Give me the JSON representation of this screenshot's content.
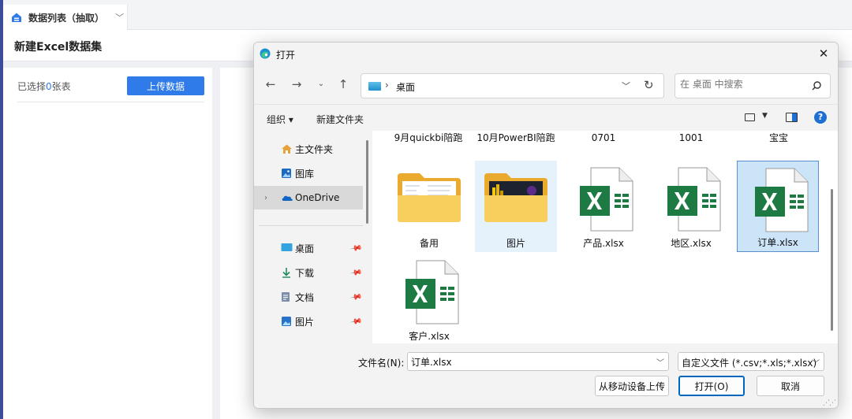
{
  "app": {
    "tab_label": "数据列表（抽取）",
    "page_title": "新建Excel数据集",
    "selected_prefix": "已选择",
    "selected_count": "0",
    "selected_suffix": "张表",
    "upload_button": "上传数据"
  },
  "dialog": {
    "title": "打开",
    "address": "桌面",
    "search_placeholder": "在 桌面 中搜索",
    "toolbar": {
      "organize": "组织 ▾",
      "new_folder": "新建文件夹"
    },
    "sidebar": [
      {
        "label": "主文件夹",
        "icon": "home-icon"
      },
      {
        "label": "图库",
        "icon": "gallery-icon"
      },
      {
        "label": "OneDrive",
        "icon": "cloud-icon",
        "active": true
      },
      {
        "label": "桌面",
        "icon": "desktop-icon",
        "pinned": true
      },
      {
        "label": "下载",
        "icon": "download-icon",
        "pinned": true
      },
      {
        "label": "文档",
        "icon": "document-icon",
        "pinned": true
      },
      {
        "label": "图片",
        "icon": "pictures-icon",
        "pinned": true
      }
    ],
    "top_row": [
      "9月quickbi陪跑",
      "10月PowerBI陪跑",
      "0701",
      "1001",
      "宝宝"
    ],
    "files": [
      {
        "name": "备用",
        "kind": "folder"
      },
      {
        "name": "图片",
        "kind": "folder-image",
        "state": "hover"
      },
      {
        "name": "产品.xlsx",
        "kind": "excel"
      },
      {
        "name": "地区.xlsx",
        "kind": "excel"
      },
      {
        "name": "订单.xlsx",
        "kind": "excel",
        "state": "selected"
      },
      {
        "name": "客户.xlsx",
        "kind": "excel"
      }
    ],
    "filename_label": "文件名(N):",
    "filename_value": "订单.xlsx",
    "filetype": "自定义文件 (*.csv;*.xls;*.xlsx)",
    "buttons": {
      "mobile_upload": "从移动设备上传",
      "open": "打开(O)",
      "cancel": "取消"
    }
  },
  "colors": {
    "accent": "#2f7bea",
    "excel_green": "#1d7a43",
    "selection": "#cce4f7",
    "folder": "#f6c343"
  }
}
